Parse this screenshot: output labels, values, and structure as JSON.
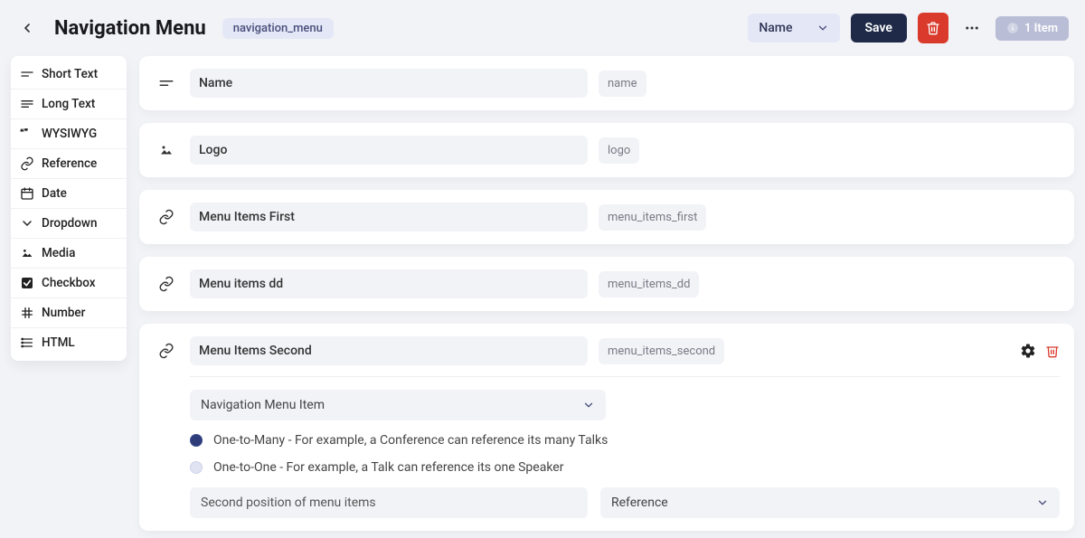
{
  "header": {
    "title": "Navigation Menu",
    "slug": "navigation_menu",
    "display_field": "Name",
    "save_label": "Save",
    "item_count_label": "1 Item"
  },
  "sidebar": {
    "items": [
      {
        "label": "Short Text",
        "icon": "short-text"
      },
      {
        "label": "Long Text",
        "icon": "long-text"
      },
      {
        "label": "WYSIWYG",
        "icon": "wysiwyg"
      },
      {
        "label": "Reference",
        "icon": "reference"
      },
      {
        "label": "Date",
        "icon": "date"
      },
      {
        "label": "Dropdown",
        "icon": "dropdown"
      },
      {
        "label": "Media",
        "icon": "media"
      },
      {
        "label": "Checkbox",
        "icon": "checkbox"
      },
      {
        "label": "Number",
        "icon": "number"
      },
      {
        "label": "HTML",
        "icon": "html"
      }
    ]
  },
  "fields": [
    {
      "name": "Name",
      "slug": "name",
      "type": "short-text",
      "icon": "short-text"
    },
    {
      "name": "Logo",
      "slug": "logo",
      "type": "media",
      "icon": "media"
    },
    {
      "name": "Menu Items First",
      "slug": "menu_items_first",
      "type": "reference",
      "icon": "reference"
    },
    {
      "name": "Menu items dd",
      "slug": "menu_items_dd",
      "type": "reference",
      "icon": "reference"
    },
    {
      "name": "Menu Items Second",
      "slug": "menu_items_second",
      "type": "reference",
      "icon": "reference",
      "expanded": true,
      "ref_model": "Navigation Menu Item",
      "relation_options": [
        {
          "label": "One-to-Many - For example, a Conference can reference its many Talks",
          "selected": true
        },
        {
          "label": "One-to-One - For example, a Talk can reference its one Speaker",
          "selected": false
        }
      ],
      "description": "Second position of menu items",
      "type_display": "Reference"
    }
  ]
}
